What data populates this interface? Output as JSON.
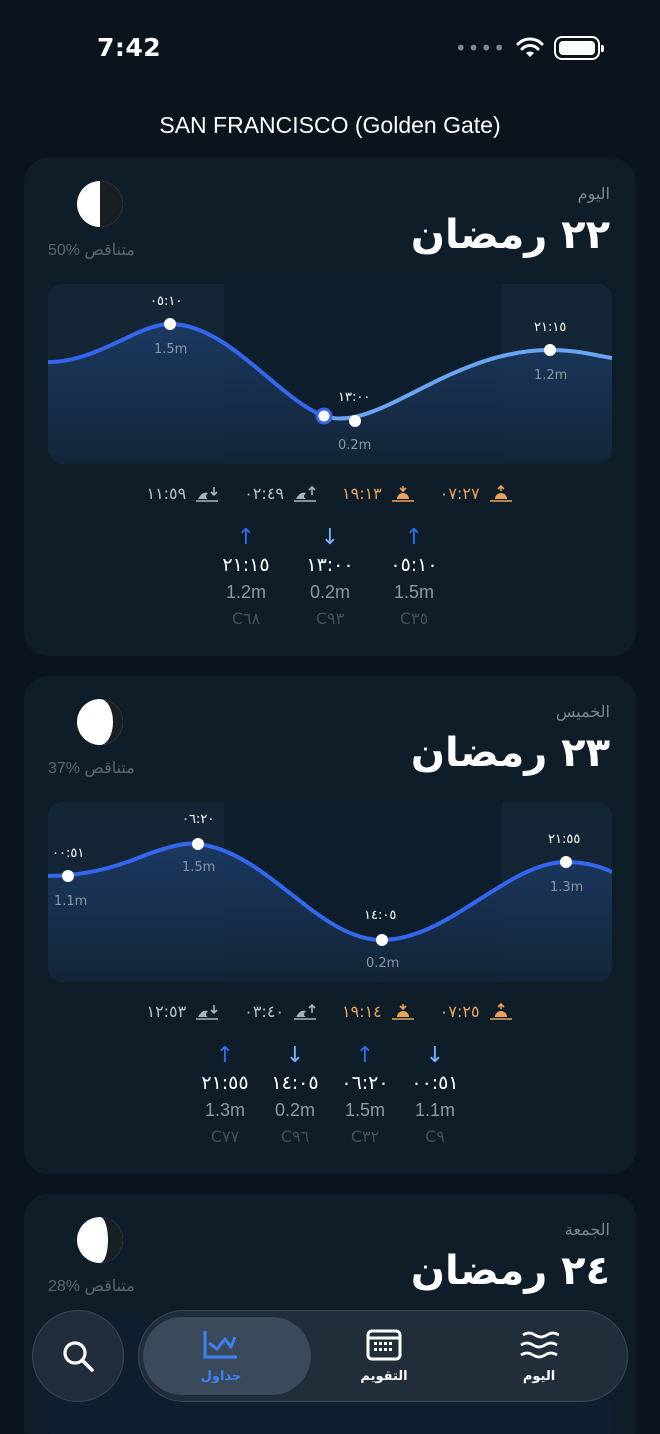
{
  "status": {
    "time": "7:42",
    "dots": "••••"
  },
  "location": "SAN FRANCISCO (Golden Gate)",
  "days": [
    {
      "day_label": "اليوم",
      "date": "٢٢ رمضان",
      "moon": "50% متناقص",
      "moon_phase": 0.5,
      "chart": {
        "points": [
          {
            "time": "٠٥:١٠",
            "height": "1.5m"
          },
          {
            "time": "١٣:٠٠",
            "height": "0.2m"
          },
          {
            "time": "٢١:١٥",
            "height": "1.2m"
          }
        ]
      },
      "events": [
        {
          "icon": "moonset-icon",
          "time": "١١:٥٩"
        },
        {
          "icon": "moonrise-icon",
          "time": "٠٢:٤٩"
        },
        {
          "icon": "sunset-icon",
          "time": "١٩:١٣"
        },
        {
          "icon": "sunrise-icon",
          "time": "٠٧:٢٧"
        }
      ],
      "tides": [
        {
          "dir": "up",
          "time": "٢١:١٥",
          "height": "1.2m",
          "coef": "C٦٨"
        },
        {
          "dir": "down",
          "time": "١٣:٠٠",
          "height": "0.2m",
          "coef": "C٩٣"
        },
        {
          "dir": "up",
          "time": "٠٥:١٠",
          "height": "1.5m",
          "coef": "C٣٥"
        }
      ]
    },
    {
      "day_label": "الخميس",
      "date": "٢٣ رمضان",
      "moon": "37% متناقص",
      "moon_phase": 0.37,
      "chart": {
        "points": [
          {
            "time": "٠٠:٥١",
            "height": "1.1m"
          },
          {
            "time": "٠٦:٢٠",
            "height": "1.5m"
          },
          {
            "time": "١٤:٠٥",
            "height": "0.2m"
          },
          {
            "time": "٢١:٥٥",
            "height": "1.3m"
          }
        ]
      },
      "events": [
        {
          "icon": "moonset-icon",
          "time": "١٢:٥٣"
        },
        {
          "icon": "moonrise-icon",
          "time": "٠٣:٤٠"
        },
        {
          "icon": "sunset-icon",
          "time": "١٩:١٤"
        },
        {
          "icon": "sunrise-icon",
          "time": "٠٧:٢٥"
        }
      ],
      "tides": [
        {
          "dir": "up",
          "time": "٢١:٥٥",
          "height": "1.3m",
          "coef": "C٧٧"
        },
        {
          "dir": "down",
          "time": "١٤:٠٥",
          "height": "0.2m",
          "coef": "C٩٦"
        },
        {
          "dir": "up",
          "time": "٠٦:٢٠",
          "height": "1.5m",
          "coef": "C٣٢"
        },
        {
          "dir": "down",
          "time": "٠٠:٥١",
          "height": "1.1m",
          "coef": "C٩"
        }
      ]
    },
    {
      "day_label": "الجمعة",
      "date": "٢٤ رمضان",
      "moon": "28% متناقص",
      "moon_phase": 0.28
    }
  ],
  "nav": {
    "tables": "جداول",
    "calendar": "التقويم",
    "today": "اليوم"
  },
  "colors": {
    "accent": "#3c82f6",
    "sun": "#e8a35c",
    "background": "#0b141d",
    "card": "#0f1d29"
  }
}
